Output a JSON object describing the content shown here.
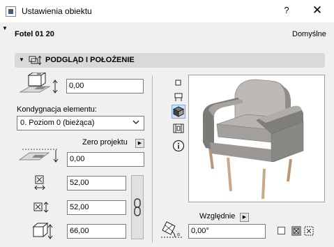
{
  "window": {
    "title": "Ustawienia obiektu",
    "help_label": "?",
    "close_label": "✕"
  },
  "header": {
    "object_name": "Fotel 01 20",
    "defaults_label": "Domyślne"
  },
  "section": {
    "title": "PODGLĄD I POŁOŻENIE"
  },
  "elevation": {
    "value": "0,00"
  },
  "story": {
    "label": "Kondygnacja elementu:",
    "selected": "0. Poziom 0 (bieżąca)"
  },
  "zero": {
    "label": "Zero projektu",
    "value": "0,00"
  },
  "dimensions": {
    "width": "52,00",
    "depth": "52,00",
    "height": "66,00"
  },
  "rotation": {
    "relative_label": "Względnie",
    "value": "0,00°"
  },
  "icons": {
    "elevation": "elevation-box-icon",
    "zero_plane": "zero-plane-icon",
    "width": "width-icon",
    "depth": "depth-icon",
    "height": "height-icon",
    "chain": "chain-link-icon",
    "view_2d": "2d-view-icon",
    "view_side": "side-view-icon",
    "view_3d": "3d-view-icon",
    "view_section": "section-view-icon",
    "view_info": "info-icon",
    "rotation": "rotation-angle-icon"
  },
  "colors": {
    "accent": "#3d7bd5",
    "chair_fabric": "#9a9895",
    "chair_legs": "#c9a98a"
  }
}
